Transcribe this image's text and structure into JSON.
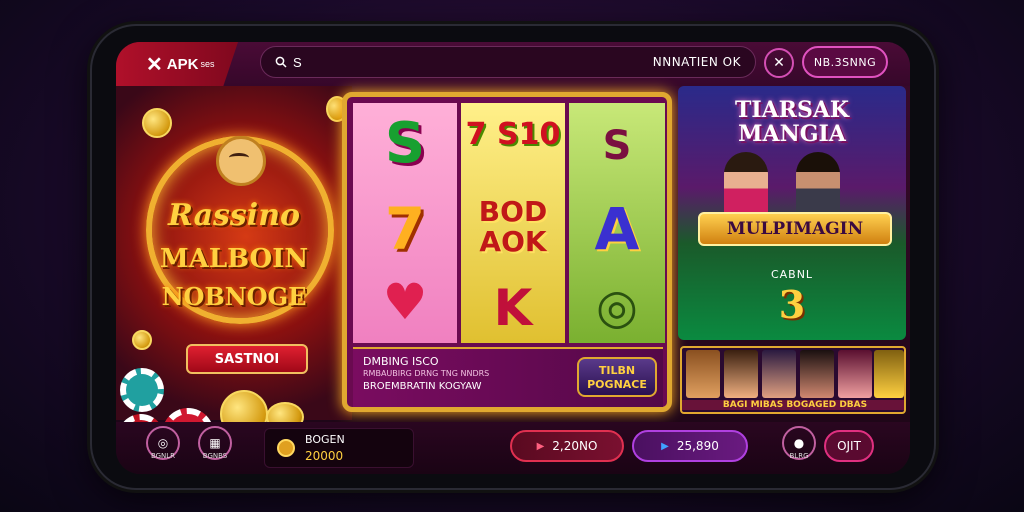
{
  "header": {
    "logo_text": "APK",
    "logo_small": "ses",
    "search_placeholder": "S",
    "search_right": "NNNATIEN OK",
    "action_icon": "close-icon",
    "pill_button": "NB.3SNNG"
  },
  "promo": {
    "line1": "Rassino",
    "line2": "MALBOIN",
    "line3": "NOBNOGE",
    "button": "SASTNOI"
  },
  "slot": {
    "reels": [
      [
        "S",
        "7",
        "♥"
      ],
      [
        "7 S10",
        "BOD AOK",
        "K"
      ],
      [
        "S",
        "A",
        "◎"
      ]
    ],
    "info_line1": "DMBING ISCO",
    "info_line2": "RMBAUBIRG DRNG TNG NNDRS",
    "info_line3": "BROEMBRATIN KOGYAW",
    "badge": "TILBN POGNACE"
  },
  "multiplayer": {
    "title_line1": "TIARSAK",
    "title_line2": "MANGIA",
    "banner": "MULPIMAGIN",
    "caption": "CABNL",
    "big_value": "3",
    "thumbs_label": "BAGI MIBAS  BOGAGED  DBAS"
  },
  "bottom": {
    "left_buttons": [
      {
        "icon": "chip-icon",
        "label": "BGNLR"
      },
      {
        "icon": "slots-icon",
        "label": "BGNBS"
      }
    ],
    "balance_label": "BOGEN",
    "balance_value": "20000",
    "button1": "2,20NO",
    "button2": "25,890",
    "user_label": "BLRG",
    "exit_button": "OJIT"
  }
}
